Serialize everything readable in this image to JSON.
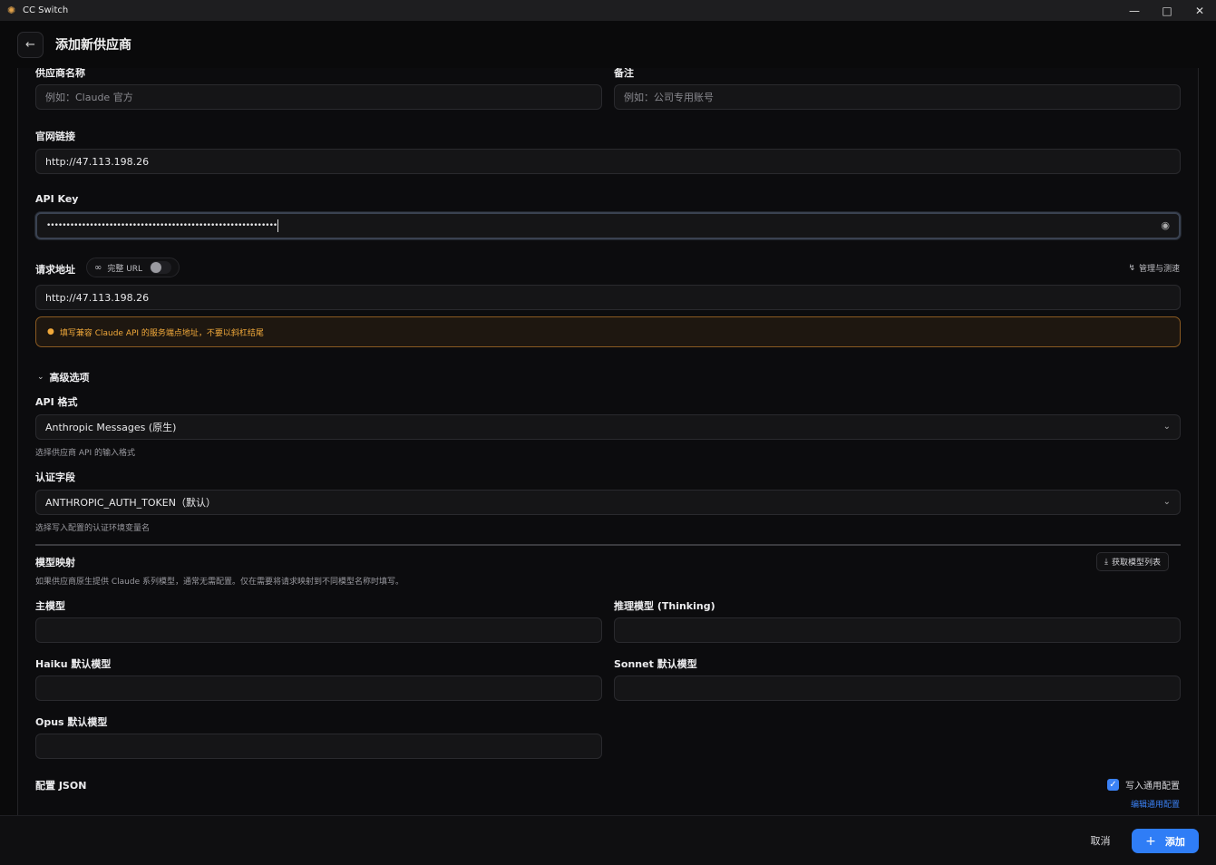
{
  "window": {
    "title": "CC Switch",
    "app_icon": "sun-icon"
  },
  "header": {
    "title": "添加新供应商"
  },
  "form": {
    "provider_name": {
      "label": "供应商名称",
      "placeholder": "例如：Claude 官方"
    },
    "notes": {
      "label": "备注",
      "placeholder": "例如：公司专用账号"
    },
    "website": {
      "label": "官网链接",
      "value": "http://47.113.198.26"
    },
    "api_key": {
      "label": "API Key",
      "value": "•••••••••••••••••••••••••••••••••••••••••••••••••••••••••••"
    },
    "endpoint": {
      "label": "请求地址",
      "full_url_label": "完整 URL",
      "full_url_enabled": false,
      "manage_label": "管理与测速",
      "value": "http://47.113.198.26",
      "warning": "填写兼容 Claude API 的服务端点地址，不要以斜杠结尾"
    },
    "advanced": {
      "label": "高级选项",
      "api_format": {
        "label": "API 格式",
        "value": "Anthropic Messages (原生)",
        "hint": "选择供应商 API 的输入格式"
      },
      "auth_field": {
        "label": "认证字段",
        "value": "ANTHROPIC_AUTH_TOKEN（默认）",
        "hint": "选择写入配置的认证环境变量名"
      }
    },
    "model_mapping": {
      "label": "模型映射",
      "fetch_button": "获取模型列表",
      "hint": "如果供应商原生提供 Claude 系列模型，通常无需配置。仅在需要将请求映射到不同模型名称时填写。",
      "main_model": {
        "label": "主模型",
        "value": ""
      },
      "thinking_model": {
        "label": "推理模型 (Thinking)",
        "value": ""
      },
      "haiku_model": {
        "label": "Haiku 默认模型",
        "value": ""
      },
      "sonnet_model": {
        "label": "Sonnet 默认模型",
        "value": ""
      },
      "opus_model": {
        "label": "Opus 默认模型",
        "value": ""
      }
    },
    "config_json": {
      "label": "配置 JSON",
      "write_common_label": "写入通用配置",
      "write_common_checked": true,
      "edit_common_link": "编辑通用配置"
    }
  },
  "footer": {
    "cancel_label": "取消",
    "add_label": "添加"
  },
  "colors": {
    "accent": "#2f7df6",
    "warning": "#f0a83a",
    "background": "#0a0a0b"
  }
}
